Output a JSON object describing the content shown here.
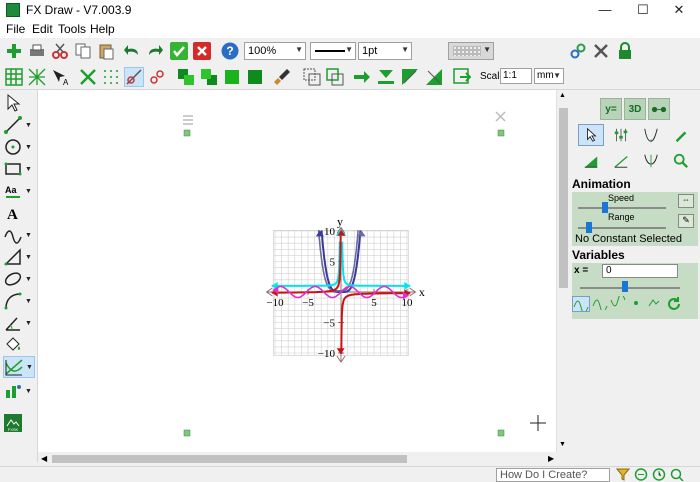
{
  "window": {
    "title": "FX Draw - V7.003.9",
    "minimize": "—",
    "maximize": "☐",
    "close": "✕"
  },
  "menu": [
    "File",
    "Edit",
    "Tools",
    "Help"
  ],
  "toolbar1": {
    "zoom": "100%",
    "line_width": "1pt",
    "line_color": "#000000",
    "fill_color": "#ff0000"
  },
  "toolbar2": {
    "scale_label": "Scale",
    "scale_value": "1:1",
    "units": "mm"
  },
  "graph": {
    "x_axis_label": "x",
    "y_axis_label": "y",
    "x_tick_labels": [
      "−10",
      "−5",
      "5",
      "10"
    ],
    "y_tick_labels": [
      "10",
      "5",
      "−5",
      "−10"
    ],
    "x_range": [
      -10,
      10
    ],
    "y_range": [
      -10,
      10
    ],
    "grid": true,
    "curve_colors": [
      "#3a3a9e",
      "#6b6b9e",
      "#00e5ee",
      "#cc1111",
      "#dd33cc",
      "#c81e2a"
    ]
  },
  "right_panel": {
    "mode_buttons": [
      "y=",
      "3D",
      "glasses"
    ],
    "animation_title": "Animation",
    "speed_label": "Speed",
    "range_label": "Range",
    "no_constant_text": "No Constant Selected",
    "variables_title": "Variables",
    "var_label": "x =",
    "var_value": "0"
  },
  "status": {
    "how_do_i": "How Do I Create?"
  },
  "colors": {
    "panel_green": "#c7dcc4",
    "accent_green": "#1f8a3c"
  }
}
